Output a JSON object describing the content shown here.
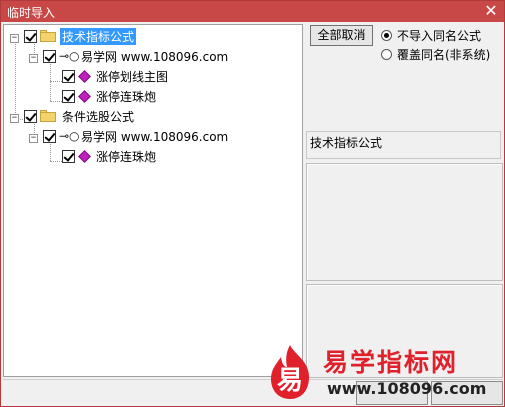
{
  "window": {
    "title": "临时导入",
    "close_glyph": "✕"
  },
  "tree": {
    "folder1": {
      "label": "技术指标公式",
      "selected": true
    },
    "author1": {
      "label": "易学网 www.108096.com"
    },
    "formula1": {
      "label": "涨停划线主图"
    },
    "formula2": {
      "label": "涨停连珠炮"
    },
    "folder2": {
      "label": "条件选股公式"
    },
    "author2": {
      "label": "易学网 www.108096.com"
    },
    "formula3": {
      "label": "涨停连珠炮"
    }
  },
  "controls": {
    "cancel_all_label": "全部取消",
    "radio_options": [
      {
        "label": "不导入同名公式",
        "checked": true
      },
      {
        "label": "覆盖同名(非系统)",
        "checked": false
      }
    ]
  },
  "info": {
    "category_text": "技术指标公式"
  },
  "watermark": {
    "badge_char": "易",
    "title": "易学指标网",
    "url": "www.108096.com"
  },
  "colors": {
    "titlebar": "#c84848",
    "selection": "#3399ff",
    "brand_red": "#e0202a"
  }
}
